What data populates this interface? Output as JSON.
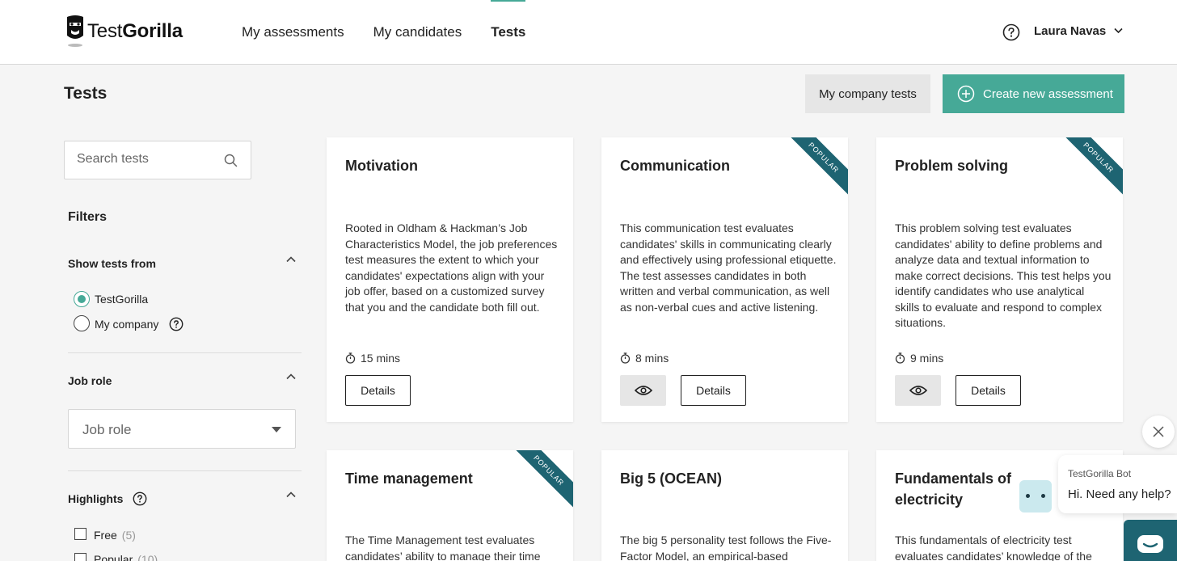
{
  "brand": {
    "name_regular": "Test",
    "name_bold": "Gorilla"
  },
  "nav": {
    "items": [
      {
        "label": "My assessments"
      },
      {
        "label": "My candidates"
      },
      {
        "label": "Tests",
        "active": true
      }
    ]
  },
  "user": {
    "name": "Laura Navas"
  },
  "page": {
    "title": "Tests",
    "company_tests_label": "My company tests",
    "create_label": "Create new assessment"
  },
  "search": {
    "placeholder": "Search tests"
  },
  "filters": {
    "title": "Filters",
    "show_from": {
      "title": "Show tests from",
      "options": [
        {
          "label": "TestGorilla",
          "checked": true
        },
        {
          "label": "My company",
          "checked": false
        }
      ]
    },
    "job_role": {
      "title": "Job role",
      "placeholder": "Job role"
    },
    "highlights": {
      "title": "Highlights",
      "options": [
        {
          "label": "Free",
          "count": "(5)"
        },
        {
          "label": "Popular",
          "count": "(10)"
        }
      ]
    }
  },
  "cards": [
    {
      "title": "Motivation",
      "description": "Rooted in Oldham & Hackman’s Job Characteristics Model, the job preferences test measures the extent to which your candidates' expectations align with your job offer, based on a customized survey that you and the candidate both fill out.",
      "duration": "15 mins",
      "popular": false,
      "details_label": "Details"
    },
    {
      "title": "Communication",
      "description": "This communication test evaluates candidates' skills in communicating clearly and effectively using professional etiquette. The test assesses candidates in both written and verbal communication, as well as non-verbal cues and active listening.",
      "duration": "8 mins",
      "popular": true,
      "details_label": "Details"
    },
    {
      "title": "Problem solving",
      "description": "This problem solving test evaluates candidates' ability to define problems and analyze data and textual information to make correct decisions. This test helps you identify candidates who use analytical skills to evaluate and respond to complex situations.",
      "duration": "9 mins",
      "popular": true,
      "details_label": "Details"
    },
    {
      "title": "Time management",
      "description": "The Time Management test evaluates candidates’ ability to manage their time",
      "popular": true
    },
    {
      "title": "Big 5 (OCEAN)",
      "description": "The big 5 personality test follows the Five-Factor Model, an empirical-based",
      "popular": false
    },
    {
      "title": "Fundamentals of electricity",
      "description": "This fundamentals of electricity test evaluates candidates’ knowledge of the",
      "popular": false
    }
  ],
  "ribbon_label": "POPULAR",
  "chat": {
    "bot_name": "TestGorilla Bot",
    "message": "Hi. Need any help?"
  },
  "colors": {
    "accent": "#46a997",
    "ribbon": "#1e6472",
    "background": "#f5f5f5"
  }
}
